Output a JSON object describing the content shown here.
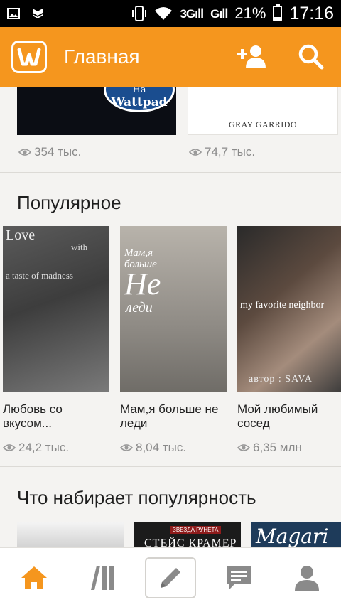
{
  "status_bar": {
    "network1": "3G",
    "network2": "G",
    "battery": "21%",
    "time": "17:16"
  },
  "app_bar": {
    "title": "Главная",
    "logo_letter": "W"
  },
  "top_row": [
    {
      "cover_text": [
        "На",
        "Wattpad"
      ],
      "views": "354 тыс."
    },
    {
      "cover_text": [
        "GRAY GARRIDO"
      ],
      "views": "74,7 тыс."
    }
  ],
  "popular": {
    "title": "Популярное",
    "books": [
      {
        "title": "Любовь со вкусом...",
        "views": "24,2 тыс.",
        "cover_text": [
          "Love",
          "with",
          "a taste of madness"
        ]
      },
      {
        "title": "Мам,я больше не леди",
        "views": "8,04 тыс.",
        "cover_text": [
          "Мам,я",
          "больше",
          "Не",
          "леди"
        ]
      },
      {
        "title": "Мой любимый сосед",
        "views": "6,35 млн",
        "cover_text": [
          "my favorite neighbor",
          "автор : SAVA"
        ]
      }
    ]
  },
  "trending": {
    "title": "Что набирает популярность",
    "covers": [
      {
        "cover_text": []
      },
      {
        "cover_text": [
          "ЗВЕЗДА РУНЕТА",
          "СТЕЙС КРАМЕР"
        ]
      },
      {
        "cover_text": [
          "Magari"
        ]
      }
    ]
  },
  "bottom_nav": [
    {
      "name": "home",
      "icon": "home-icon",
      "active": true
    },
    {
      "name": "library",
      "icon": "library-icon",
      "active": false
    },
    {
      "name": "write",
      "icon": "pencil-icon",
      "active": false
    },
    {
      "name": "messages",
      "icon": "chat-icon",
      "active": false
    },
    {
      "name": "profile",
      "icon": "user-icon",
      "active": false
    }
  ],
  "colors": {
    "brand": "#f5961e",
    "active_nav": "#f5961e",
    "inactive_nav": "#8a8a8a"
  }
}
